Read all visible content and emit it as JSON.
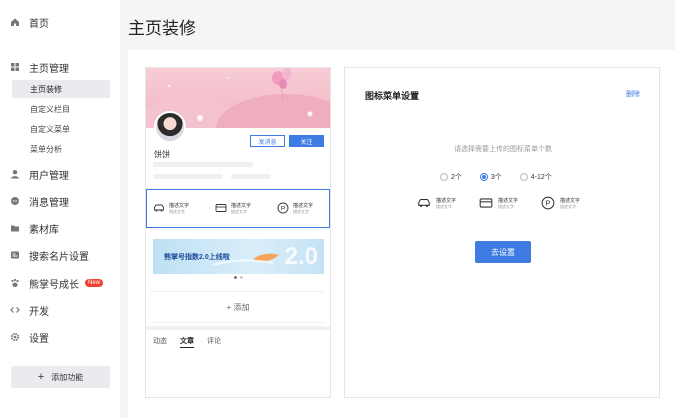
{
  "sidebar": {
    "items": [
      {
        "label": "首页",
        "icon": "home-icon"
      },
      {
        "label": "主页管理",
        "icon": "grid-icon"
      },
      {
        "label": "用户管理",
        "icon": "user-icon"
      },
      {
        "label": "消息管理",
        "icon": "message-icon"
      },
      {
        "label": "素材库",
        "icon": "folder-icon"
      },
      {
        "label": "搜索名片设置",
        "icon": "card-icon"
      },
      {
        "label": "熊掌号成长",
        "icon": "paw-icon",
        "badge": "New"
      },
      {
        "label": "开发",
        "icon": "code-icon"
      },
      {
        "label": "设置",
        "icon": "gear-icon"
      }
    ],
    "sub_items": [
      {
        "label": "主页装修",
        "active": true
      },
      {
        "label": "自定义栏目",
        "active": false
      },
      {
        "label": "自定义菜单",
        "active": false
      },
      {
        "label": "菜单分析",
        "active": false
      }
    ],
    "add_button": "添加功能"
  },
  "page": {
    "title": "主页装修"
  },
  "preview": {
    "name": "饼饼",
    "message_button": "发消息",
    "follow_button": "关注",
    "menu": [
      {
        "title": "描述文字",
        "subtitle": "描述文字",
        "icon": "car-icon"
      },
      {
        "title": "描述文字",
        "subtitle": "描述文字",
        "icon": "card-icon"
      },
      {
        "title": "描述文字",
        "subtitle": "描述文字",
        "icon": "parking-icon"
      }
    ],
    "banner_text": "熊掌号指数2.0上线啦",
    "banner_big": "2.0",
    "add_label": "+ 添加",
    "tabs": [
      "动态",
      "文章",
      "评论"
    ],
    "active_tab": "文章"
  },
  "settings": {
    "title": "图标菜单设置",
    "delete_label": "删除",
    "hint": "请选择需要上传的图标菜单个数",
    "options": [
      "2个",
      "3个",
      "4-12个"
    ],
    "selected_option": "3个",
    "menu": [
      {
        "title": "描述文字",
        "subtitle": "描述文字",
        "icon": "car-icon"
      },
      {
        "title": "描述文字",
        "subtitle": "描述文字",
        "icon": "card-icon"
      },
      {
        "title": "描述文字",
        "subtitle": "描述文字",
        "icon": "parking-icon"
      }
    ],
    "setup_button": "去设置"
  },
  "colors": {
    "accent": "#3e7ce4",
    "sidebar_active": "#e9ebee",
    "banner_pink": "#f2b6c4"
  }
}
